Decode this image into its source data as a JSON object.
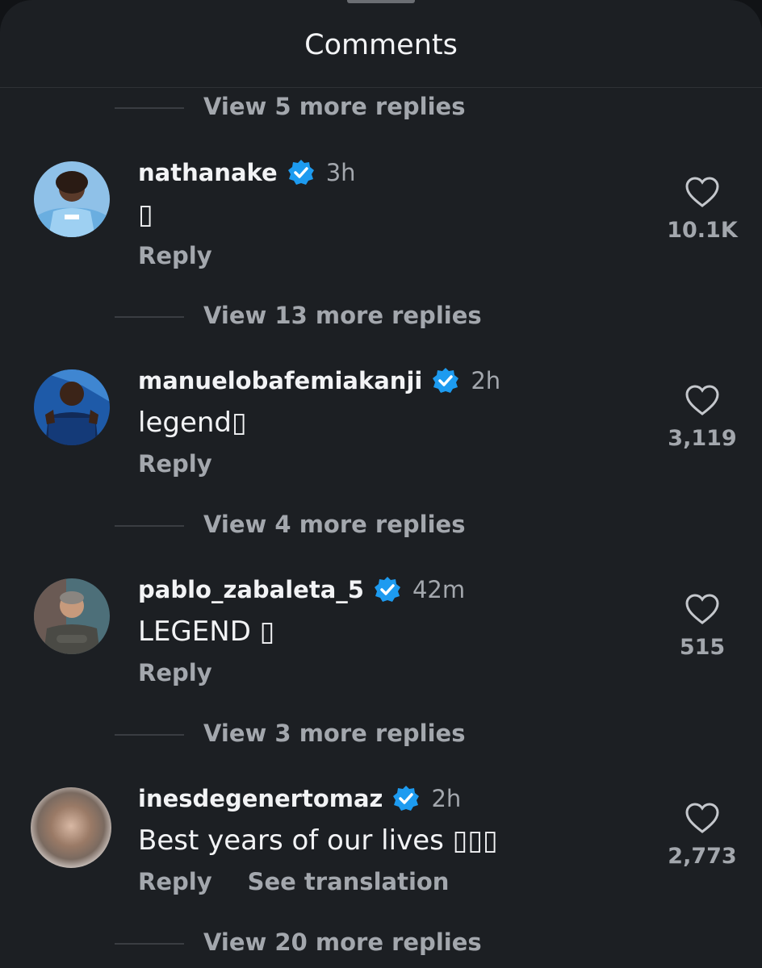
{
  "header": {
    "title": "Comments"
  },
  "threads": [
    {
      "label": "View 5 more replies"
    },
    {
      "label": "View 13 more replies"
    },
    {
      "label": "View 4 more replies"
    },
    {
      "label": "View 3 more replies"
    },
    {
      "label": "View 20 more replies"
    }
  ],
  "comments": [
    {
      "username": "nathanake",
      "verified": true,
      "time": "3h",
      "text": "▯",
      "reply_label": "Reply",
      "likes": "10.1K"
    },
    {
      "username": "manuelobafemiakanji",
      "verified": true,
      "time": "2h",
      "text": "legend▯",
      "reply_label": "Reply",
      "likes": "3,119"
    },
    {
      "username": "pablo_zabaleta_5",
      "verified": true,
      "time": "42m",
      "text": "LEGEND ▯",
      "reply_label": "Reply",
      "likes": "515"
    },
    {
      "username": "inesdegenertomaz",
      "verified": true,
      "time": "2h",
      "text": "Best years of our lives ▯▯▯",
      "reply_label": "Reply",
      "translate_label": "See translation",
      "likes": "2,773"
    }
  ],
  "colors": {
    "background": "#1c1f23",
    "primary_text": "#f2f3f5",
    "secondary_text": "#a3a7ad",
    "verified_badge": "#1d9bf0"
  }
}
